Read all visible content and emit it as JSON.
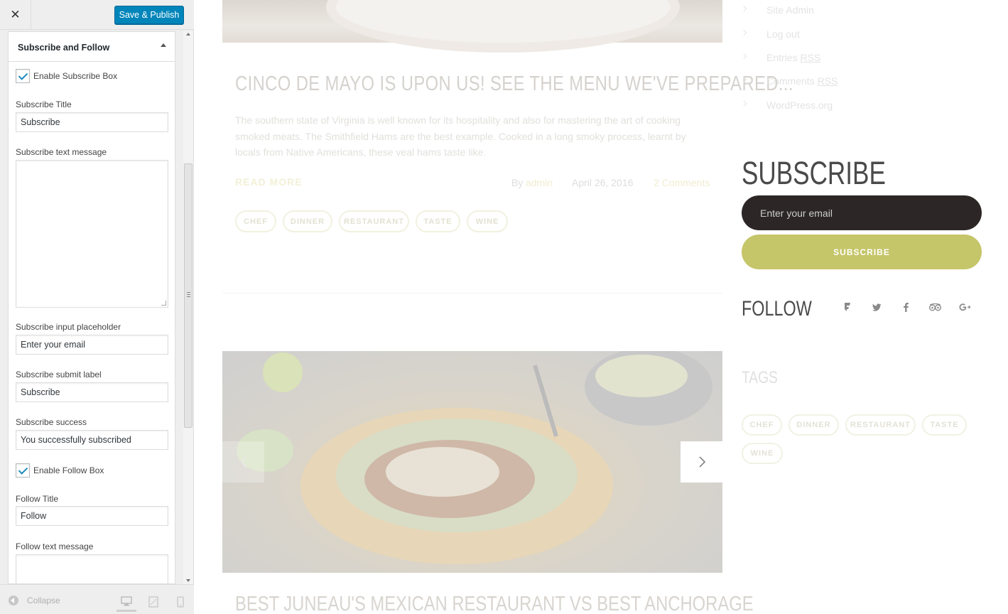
{
  "customizer": {
    "save_label": "Save & Publish",
    "section_title": "Subscribe and Follow",
    "enable_subscribe_label": "Enable Subscribe Box",
    "subscribe_title_label": "Subscribe Title",
    "subscribe_title_value": "Subscribe",
    "subscribe_text_label": "Subscribe text message",
    "subscribe_text_value": "",
    "subscribe_placeholder_label": "Subscribe input placeholder",
    "subscribe_placeholder_value": "Enter your email",
    "subscribe_submit_label": "Subscribe submit label",
    "subscribe_submit_value": "Subscribe",
    "subscribe_success_label": "Subscribe success",
    "subscribe_success_value": "You successfully subscribed",
    "enable_follow_label": "Enable Follow Box",
    "follow_title_label": "Follow Title",
    "follow_title_value": "Follow",
    "follow_text_label": "Follow text message",
    "collapse_label": "Collapse"
  },
  "preview": {
    "post": {
      "title": "CINCO DE MAYO IS UPON US! SEE THE MENU WE'VE PREPARED...",
      "excerpt": "The southern state of Virginia is well known for its hospitality and also for mastering the art of cooking smoked meats. The Smithfield Hams are the best example. Cooked in a long smoky process, learnt by locals from Native Americans, these veal hams taste like.",
      "read_more": "READ MORE",
      "by": "By",
      "author": "admin",
      "date": "April 26, 2016",
      "comments": "2 Comments",
      "tags": [
        "CHEF",
        "DINNER",
        "RESTAURANT",
        "TASTE",
        "WINE"
      ]
    },
    "next_post_title": "BEST JUNEAU'S MEXICAN RESTAURANT VS BEST ANCHORAGE",
    "meta_links": {
      "site_admin": "Site Admin",
      "log_out": "Log out",
      "entries": "Entries",
      "comments": "Comments",
      "rss": "RSS",
      "wordpress": "WordPress.org"
    },
    "subscribe": {
      "heading": "SUBSCRIBE",
      "placeholder": "Enter your email",
      "button": "SUBSCRIBE"
    },
    "follow": {
      "heading": "FOLLOW",
      "icons": [
        "foursquare-icon",
        "twitter-icon",
        "facebook-icon",
        "tripadvisor-icon",
        "google-plus-icon"
      ]
    },
    "tags": {
      "heading": "TAGS",
      "items": [
        "CHEF",
        "DINNER",
        "RESTAURANT",
        "TASTE",
        "WINE"
      ]
    }
  },
  "colors": {
    "wp_blue": "#0085ba",
    "subscribe_button": "#c5c569",
    "subscribe_input": "#2c2726"
  }
}
